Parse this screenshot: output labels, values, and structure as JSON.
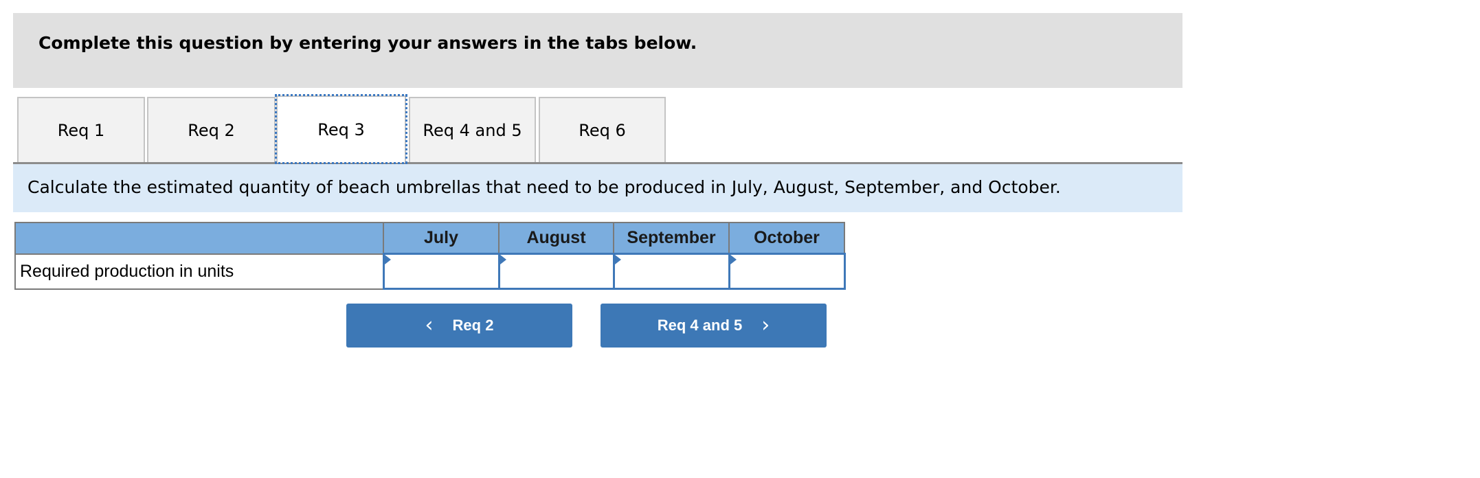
{
  "instructions": {
    "text": "Complete this question by entering your answers in the tabs below."
  },
  "tabs": [
    {
      "label": "Req 1",
      "active": false
    },
    {
      "label": "Req 2",
      "active": false
    },
    {
      "label": "Req 3",
      "active": true
    },
    {
      "label": "Req 4 and 5",
      "active": false
    },
    {
      "label": "Req 6",
      "active": false
    }
  ],
  "prompt": {
    "text": "Calculate the estimated quantity of beach umbrellas that need to be produced in July, August, September, and October."
  },
  "table": {
    "columns": [
      "",
      "July",
      "August",
      "September",
      "October"
    ],
    "rows": [
      {
        "label": "Required production in units",
        "values": [
          "",
          "",
          "",
          ""
        ]
      }
    ]
  },
  "nav": {
    "prev_label": "Req 2",
    "next_label": "Req 4 and 5",
    "prev_icon": "chevron-left-icon",
    "next_icon": "chevron-right-icon"
  },
  "colors": {
    "accent": "#3d78b6",
    "header": "#7badde",
    "band": "#dbeaf8"
  }
}
